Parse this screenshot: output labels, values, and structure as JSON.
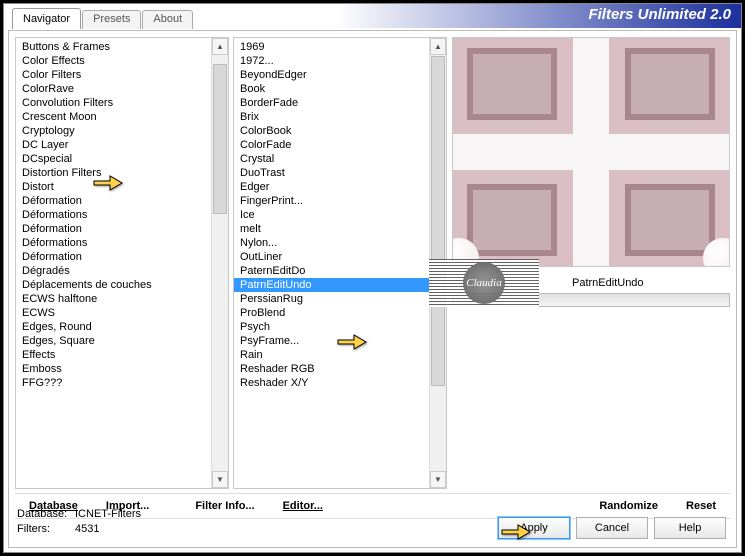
{
  "title": "Filters Unlimited 2.0",
  "tabs": {
    "navigator": "Navigator",
    "presets": "Presets",
    "about": "About"
  },
  "categories": [
    "Buttons & Frames",
    "Color Effects",
    "Color Filters",
    "ColorRave",
    "Convolution Filters",
    "Crescent Moon",
    "Cryptology",
    "DC Layer",
    "DCspecial",
    "Distortion Filters",
    "Distort",
    "Déformation",
    "Déformations",
    "Déformation",
    "Déformations",
    "Déformation",
    "Dégradés",
    "Déplacements de couches",
    "ECWS halftone",
    "ECWS",
    "Edges, Round",
    "Edges, Square",
    "Effects",
    "Emboss",
    "FFG???"
  ],
  "categories_selected_index": 8,
  "filters": [
    "1969",
    "1972...",
    "BeyondEdger",
    "Book",
    "BorderFade",
    "Brix",
    "ColorBook",
    "ColorFade",
    "Crystal",
    "DuoTrast",
    "Edger",
    "FingerPrint...",
    "Ice",
    "melt",
    "Nylon...",
    "OutLiner",
    "PaternEditDo",
    "PatrnEditUndo",
    "PerssianRug",
    "ProBlend",
    "Psych",
    "PsyFrame...",
    "Rain",
    "Reshader RGB",
    "Reshader X/Y"
  ],
  "filters_selected_index": 17,
  "param_label": "PatrnEditUndo",
  "toolbar": {
    "database": "Database",
    "import": "Import...",
    "filterinfo": "Filter Info...",
    "editor": "Editor...",
    "randomize": "Randomize",
    "reset": "Reset"
  },
  "status": {
    "db_label": "Database:",
    "db_value": "ICNET-Filters",
    "count_label": "Filters:",
    "count_value": "4531"
  },
  "buttons": {
    "apply": "Apply",
    "cancel": "Cancel",
    "help": "Help"
  }
}
